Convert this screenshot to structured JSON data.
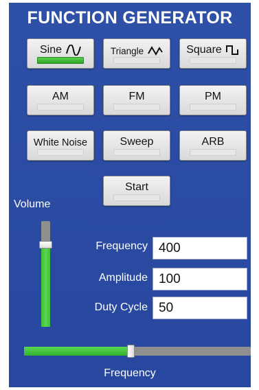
{
  "title": "FUNCTION GENERATOR",
  "buttons": {
    "sine": {
      "label": "Sine",
      "icon": "sine-wave-icon",
      "active": true
    },
    "triangle": {
      "label": "Triangle",
      "icon": "triangle-wave-icon",
      "active": false
    },
    "square": {
      "label": "Square",
      "icon": "square-wave-icon",
      "active": false
    },
    "am": {
      "label": "AM",
      "active": false
    },
    "fm": {
      "label": "FM",
      "active": false
    },
    "pm": {
      "label": "PM",
      "active": false
    },
    "white_noise": {
      "label": "White Noise",
      "active": false
    },
    "sweep": {
      "label": "Sweep",
      "active": false
    },
    "arb": {
      "label": "ARB",
      "active": false
    },
    "start": {
      "label": "Start",
      "active": false
    }
  },
  "volume": {
    "label": "Volume",
    "level": 0.8
  },
  "fields": {
    "frequency": {
      "label": "Frequency",
      "value": "400"
    },
    "amplitude": {
      "label": "Amplitude",
      "value": "100"
    },
    "duty_cycle": {
      "label": "Duty Cycle",
      "value": "50"
    }
  },
  "frequency_slider": {
    "label": "Frequency",
    "level": 0.47
  },
  "colors": {
    "panel": "#2a4aa0",
    "indicator_on": "#3fbf3a",
    "slider_fill": "#4cc944"
  }
}
